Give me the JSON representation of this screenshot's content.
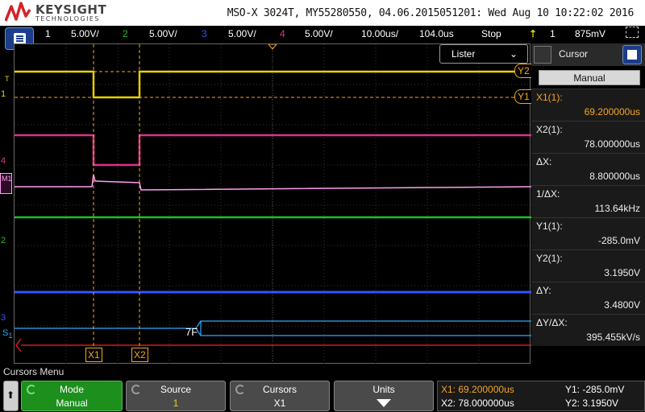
{
  "header": {
    "brand": "KEYSIGHT",
    "brand_sub": "TECHNOLOGIES",
    "info": "MSO-X 3024T, MY55280550, 04.06.2015051201: Wed Aug 10 10:22:02 2016"
  },
  "status": {
    "ch1_num": "1",
    "ch1_scale": "5.00V/",
    "ch2_num": "2",
    "ch2_scale": "5.00V/",
    "ch3_num": "3",
    "ch3_scale": "5.00V/",
    "ch4_num": "4",
    "ch4_scale": "5.00V/",
    "timebase": "10.00us/",
    "delay": "104.0us",
    "run_state": "Stop",
    "trigger_icon": "trigger-rising-edge-icon",
    "trigger_source": "1",
    "trigger_level": "875mV",
    "colors": {
      "ch1": "#e6d200",
      "ch2": "#22c022",
      "ch3": "#3355ff",
      "ch4": "#e0308a",
      "math": "#ff9ef0",
      "bus": "#2da8ff",
      "cursor": "#f5a623"
    }
  },
  "plot": {
    "listener_label": "Lister",
    "listener_icon": "chevron-down-icon",
    "y2_label": "Y2",
    "y1_label": "Y1",
    "x1_label": "X1",
    "x2_label": "X2",
    "ch1_marker": "1",
    "ch4_marker": "4",
    "ch2_marker": "2",
    "ch3_marker": "3",
    "math_marker": "M1",
    "trigger_marker": "T",
    "bus_marker": "S",
    "bus_marker_sub": "1",
    "bus_value": "7F"
  },
  "cursor_panel": {
    "title": "Cursor",
    "mode_value": "Manual",
    "rows": [
      {
        "label": "X1(1):",
        "value": "69.200000us"
      },
      {
        "label": "X2(1):",
        "value": "78.000000us"
      },
      {
        "label": "ΔX:",
        "value": "8.800000us"
      },
      {
        "label": "1/ΔX:",
        "value": "113.64kHz"
      },
      {
        "label": "Y1(1):",
        "value": "-285.0mV"
      },
      {
        "label": "Y2(1):",
        "value": "3.1950V"
      },
      {
        "label": "ΔY:",
        "value": "3.4800V"
      },
      {
        "label": "ΔY/ΔX:",
        "value": "395.455kV/s"
      }
    ]
  },
  "softkeys": {
    "menu_title": "Cursors Menu",
    "up_icon": "up-arrow-icon",
    "mode_title": "Mode",
    "mode_value": "Manual",
    "source_title": "Source",
    "source_value": "1",
    "cursors_title": "Cursors",
    "cursors_value": "X1",
    "units_title": "Units",
    "units_icon": "down-arrow-icon"
  },
  "readout": {
    "x1": "X1: 69.200000us",
    "x2": "X2: 78.000000us",
    "y1": "Y1: -285.0mV",
    "y2": "Y2: 3.1950V"
  }
}
